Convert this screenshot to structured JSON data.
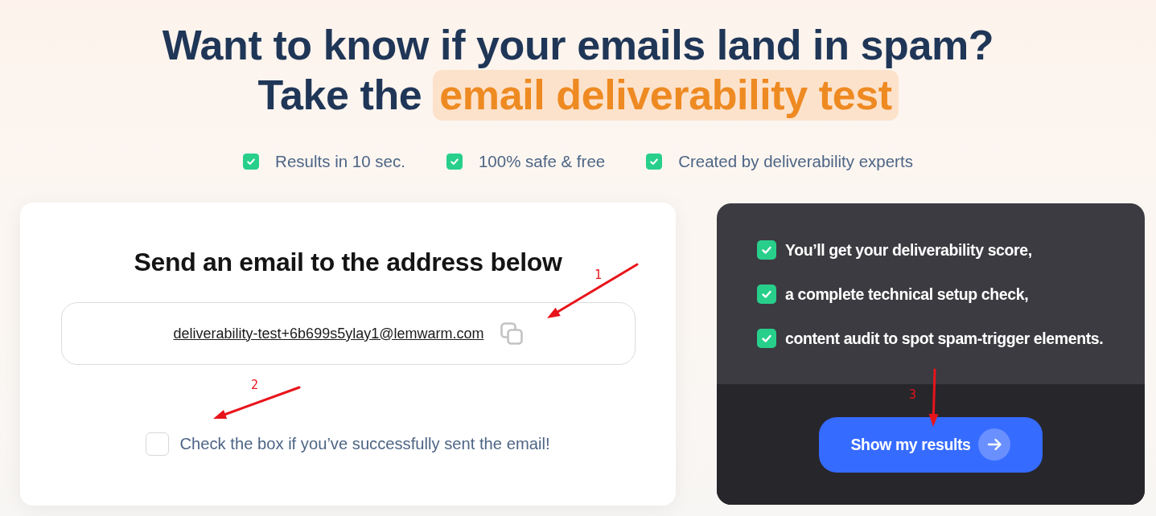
{
  "headline": {
    "line_1": "Want to know if your emails land in spam?",
    "line_2_lead": "Take the",
    "line_2_highlight": "email deliverability test"
  },
  "features": [
    "Results in 10 sec.",
    "100% safe & free",
    "Created by deliverability experts"
  ],
  "send_card": {
    "title": "Send an email to the address below",
    "email": {
      "address": "deliverability-test+6b699s5ylay1@lemwarm.com",
      "annotation": "1"
    },
    "confirm": {
      "label": "Check the box if you’ve successfully sent the email!",
      "checked": false,
      "annotation": "2"
    }
  },
  "results_card": {
    "benefits": [
      "You’ll get your deliverability score,",
      "a complete technical setup check,",
      "content audit to spot spam-trigger elements."
    ],
    "button": {
      "label": "Show my results",
      "annotation": "3"
    }
  }
}
